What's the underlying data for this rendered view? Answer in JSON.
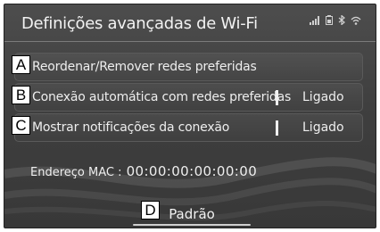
{
  "header": {
    "title": "Definições avançadas de Wi-Fi"
  },
  "status_icons": [
    "signal-icon",
    "battery-icon",
    "bluetooth-icon",
    "wifi-icon"
  ],
  "rows": [
    {
      "callout": "A",
      "label": "Reordenar/Remover redes preferidas",
      "value": ""
    },
    {
      "callout": "B",
      "label": "Conexão automática com redes preferidas",
      "value": "Ligado"
    },
    {
      "callout": "C",
      "label": "Mostrar notificações da conexão",
      "value": "Ligado"
    }
  ],
  "mac": {
    "label": "Endereço MAC :",
    "value": "00:00:00:00:00:00"
  },
  "default_button": {
    "callout": "D",
    "label": "Padrão"
  }
}
